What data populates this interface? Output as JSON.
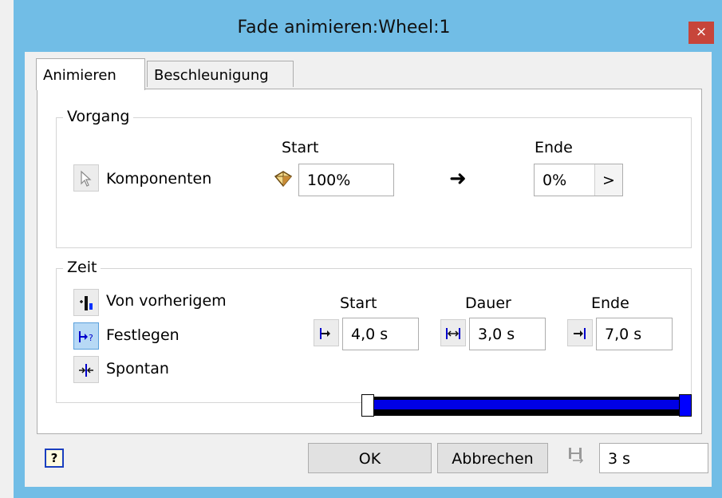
{
  "window": {
    "title": "Fade animieren:Wheel:1",
    "close_symbol": "×"
  },
  "tabs": [
    {
      "label": "Animieren",
      "active": true
    },
    {
      "label": "Beschleunigung",
      "active": false
    }
  ],
  "vorgang": {
    "legend": "Vorgang",
    "start_label": "Start",
    "end_label": "Ende",
    "komponenten_label": "Komponenten",
    "start_value": "100%",
    "end_value": "0%",
    "arrow_symbol": "➜",
    "expand_symbol": ">"
  },
  "zeit": {
    "legend": "Zeit",
    "options": [
      {
        "label": "Von vorherigem",
        "icon": "from-previous-icon",
        "selected": false
      },
      {
        "label": "Festlegen",
        "icon": "specify-icon",
        "selected": true
      },
      {
        "label": "Spontan",
        "icon": "instantaneous-icon",
        "selected": false
      }
    ],
    "start_label": "Start",
    "duration_label": "Dauer",
    "end_label": "Ende",
    "start_value": "4,0 s",
    "duration_value": "3,0 s",
    "end_value": "7,0 s"
  },
  "footer": {
    "help_symbol": "?",
    "ok_label": "OK",
    "cancel_label": "Abbrechen",
    "time_value": "3 s"
  },
  "colors": {
    "titlebar": "#71bde6",
    "close": "#c7453a",
    "bar": "#0000e6"
  }
}
